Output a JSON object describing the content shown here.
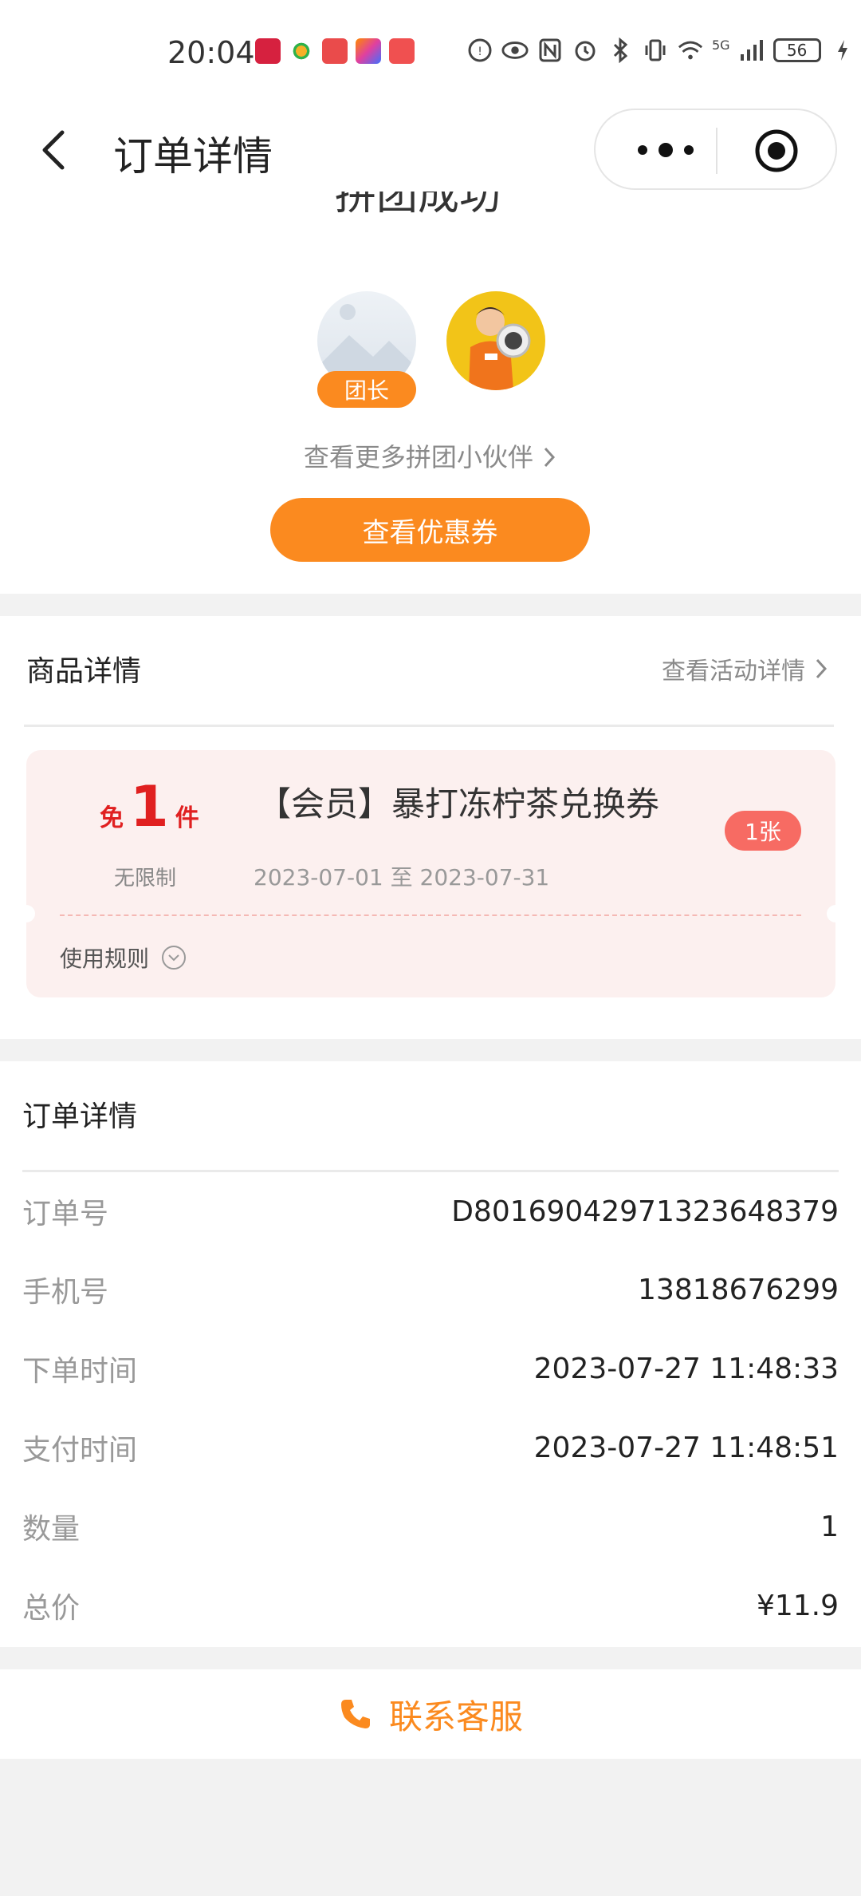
{
  "status_bar": {
    "time": "20:04",
    "network": "5G",
    "battery": "56"
  },
  "nav": {
    "title": "订单详情"
  },
  "group": {
    "title": "拼团成功",
    "leader_badge": "团长",
    "more_partners": "查看更多拼团小伙伴",
    "view_coupon_button": "查看优惠券"
  },
  "product": {
    "section_title": "商品详情",
    "activity_link": "查看活动详情",
    "coupon": {
      "free_prefix": "免",
      "free_count": "1",
      "free_unit": "件",
      "limit_text": "无限制",
      "name": "【会员】暴打冻柠茶兑换券",
      "validity": "2023-07-01 至 2023-07-31",
      "quantity_badge": "1张",
      "rules_label": "使用规则"
    }
  },
  "order": {
    "section_title": "订单详情",
    "rows": [
      {
        "label": "订单号",
        "value": "D801690429713236483​79"
      },
      {
        "label": "手机号",
        "value": "13818676299"
      },
      {
        "label": "下单时间",
        "value": "2023-07-27 11:48:33"
      },
      {
        "label": "支付时间",
        "value": "2023-07-27 11:48:51"
      },
      {
        "label": "数量",
        "value": "1"
      },
      {
        "label": "总价",
        "value": "¥11.9"
      }
    ]
  },
  "footer": {
    "contact_label": "联系客服"
  },
  "colors": {
    "accent": "#fb8a1f",
    "price_red": "#e02020",
    "badge_red": "#f76b63",
    "coupon_bg": "#fcf0ef"
  }
}
